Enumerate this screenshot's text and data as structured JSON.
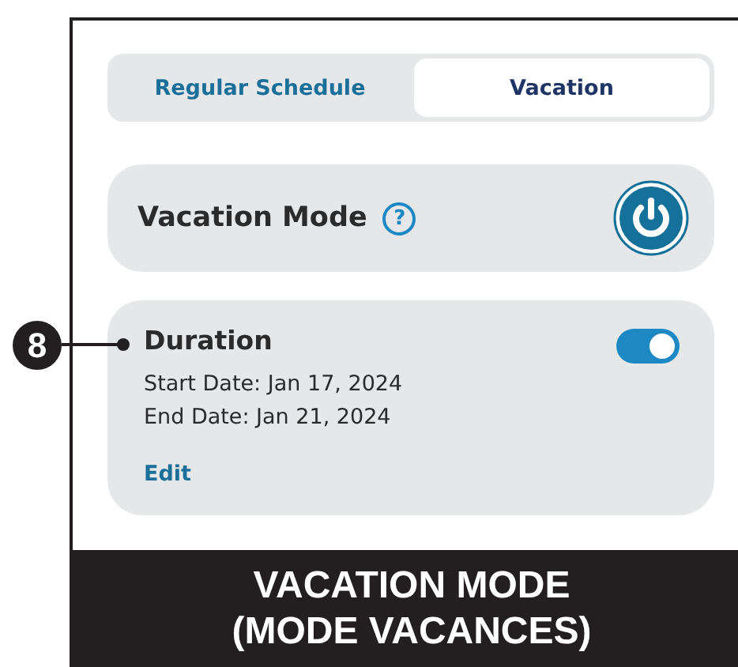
{
  "tabs": [
    {
      "label": "Regular Schedule",
      "selected": false
    },
    {
      "label": "Vacation",
      "selected": true
    }
  ],
  "vacation_mode": {
    "label": "Vacation Mode",
    "help": "?",
    "power_on": true
  },
  "duration": {
    "title": "Duration",
    "toggle_on": true,
    "start_date": "Start Date: Jan 17, 2024",
    "end_date": "End Date: Jan 21, 2024",
    "edit": "Edit"
  },
  "callout": {
    "number": "8"
  },
  "caption": {
    "lines": [
      "VACATION MODE",
      "(MODE VACANCES)"
    ]
  }
}
